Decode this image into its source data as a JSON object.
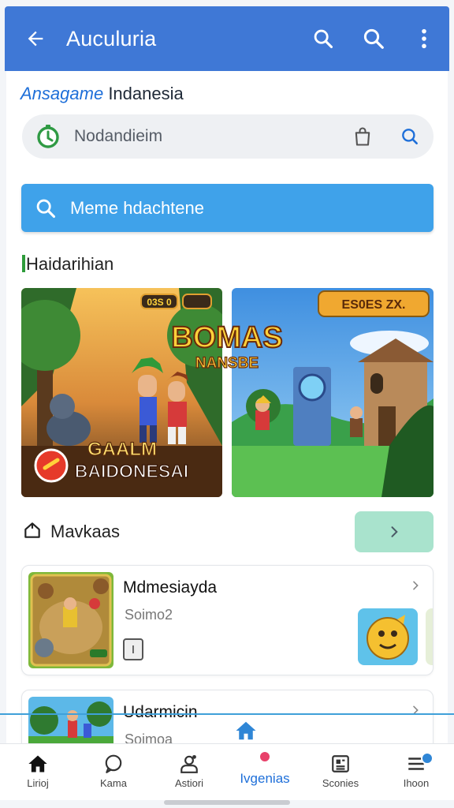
{
  "appbar": {
    "title": "Auculuria"
  },
  "header": {
    "brand_part1": "Ansagame",
    "brand_part2": "Indanesia"
  },
  "search": {
    "placeholder": "Nodandieim"
  },
  "action_bar": {
    "label": "Meme hdachtene"
  },
  "section": {
    "title": "Haidarihian"
  },
  "banners": [
    {
      "badge_top": "03S 0",
      "title_line1": "BOMAS",
      "title_line2": "NANSBE",
      "bottom_line1": "GAALM",
      "bottom_line2": "BAIDONESAI"
    },
    {
      "badge_top": "ES0ES ZX."
    }
  ],
  "category": {
    "title": "Mavkaas"
  },
  "list": [
    {
      "name": "Mdmesiayda",
      "subtitle": "Soimo2",
      "badge": "I"
    },
    {
      "name": "Udarmicin",
      "subtitle": "Soimoa"
    }
  ],
  "bottom_nav": [
    {
      "label": "Lirioj",
      "icon": "home-icon"
    },
    {
      "label": "Kama",
      "icon": "chat-icon"
    },
    {
      "label": "Astiori",
      "icon": "person-icon"
    },
    {
      "label": "Ivgenias",
      "icon": "home-fab-icon"
    },
    {
      "label": "Sconies",
      "icon": "news-icon"
    },
    {
      "label": "Ihoon",
      "icon": "menu-icon"
    }
  ],
  "colors": {
    "appbar": "#3f78d6",
    "action_bar": "#3fa2ea",
    "accent": "#1e6fd9",
    "more_button": "#a9e3cd",
    "notification": "#e8416a"
  }
}
